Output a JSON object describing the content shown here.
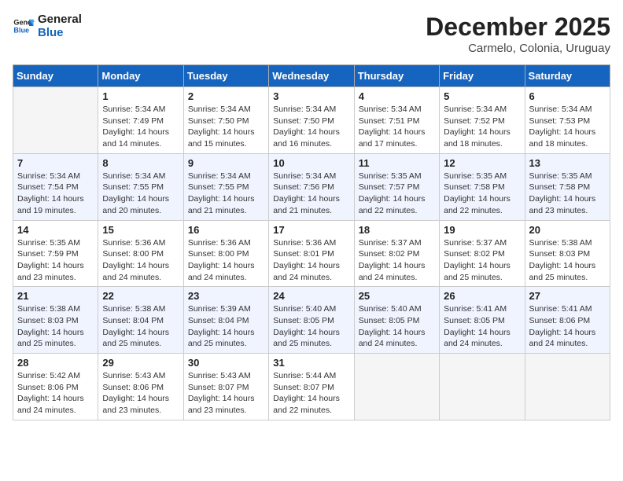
{
  "logo": {
    "line1": "General",
    "line2": "Blue"
  },
  "title": "December 2025",
  "location": "Carmelo, Colonia, Uruguay",
  "days_of_week": [
    "Sunday",
    "Monday",
    "Tuesday",
    "Wednesday",
    "Thursday",
    "Friday",
    "Saturday"
  ],
  "weeks": [
    [
      {
        "num": "",
        "info": ""
      },
      {
        "num": "1",
        "info": "Sunrise: 5:34 AM\nSunset: 7:49 PM\nDaylight: 14 hours\nand 14 minutes."
      },
      {
        "num": "2",
        "info": "Sunrise: 5:34 AM\nSunset: 7:50 PM\nDaylight: 14 hours\nand 15 minutes."
      },
      {
        "num": "3",
        "info": "Sunrise: 5:34 AM\nSunset: 7:50 PM\nDaylight: 14 hours\nand 16 minutes."
      },
      {
        "num": "4",
        "info": "Sunrise: 5:34 AM\nSunset: 7:51 PM\nDaylight: 14 hours\nand 17 minutes."
      },
      {
        "num": "5",
        "info": "Sunrise: 5:34 AM\nSunset: 7:52 PM\nDaylight: 14 hours\nand 18 minutes."
      },
      {
        "num": "6",
        "info": "Sunrise: 5:34 AM\nSunset: 7:53 PM\nDaylight: 14 hours\nand 18 minutes."
      }
    ],
    [
      {
        "num": "7",
        "info": "Sunrise: 5:34 AM\nSunset: 7:54 PM\nDaylight: 14 hours\nand 19 minutes."
      },
      {
        "num": "8",
        "info": "Sunrise: 5:34 AM\nSunset: 7:55 PM\nDaylight: 14 hours\nand 20 minutes."
      },
      {
        "num": "9",
        "info": "Sunrise: 5:34 AM\nSunset: 7:55 PM\nDaylight: 14 hours\nand 21 minutes."
      },
      {
        "num": "10",
        "info": "Sunrise: 5:34 AM\nSunset: 7:56 PM\nDaylight: 14 hours\nand 21 minutes."
      },
      {
        "num": "11",
        "info": "Sunrise: 5:35 AM\nSunset: 7:57 PM\nDaylight: 14 hours\nand 22 minutes."
      },
      {
        "num": "12",
        "info": "Sunrise: 5:35 AM\nSunset: 7:58 PM\nDaylight: 14 hours\nand 22 minutes."
      },
      {
        "num": "13",
        "info": "Sunrise: 5:35 AM\nSunset: 7:58 PM\nDaylight: 14 hours\nand 23 minutes."
      }
    ],
    [
      {
        "num": "14",
        "info": "Sunrise: 5:35 AM\nSunset: 7:59 PM\nDaylight: 14 hours\nand 23 minutes."
      },
      {
        "num": "15",
        "info": "Sunrise: 5:36 AM\nSunset: 8:00 PM\nDaylight: 14 hours\nand 24 minutes."
      },
      {
        "num": "16",
        "info": "Sunrise: 5:36 AM\nSunset: 8:00 PM\nDaylight: 14 hours\nand 24 minutes."
      },
      {
        "num": "17",
        "info": "Sunrise: 5:36 AM\nSunset: 8:01 PM\nDaylight: 14 hours\nand 24 minutes."
      },
      {
        "num": "18",
        "info": "Sunrise: 5:37 AM\nSunset: 8:02 PM\nDaylight: 14 hours\nand 24 minutes."
      },
      {
        "num": "19",
        "info": "Sunrise: 5:37 AM\nSunset: 8:02 PM\nDaylight: 14 hours\nand 25 minutes."
      },
      {
        "num": "20",
        "info": "Sunrise: 5:38 AM\nSunset: 8:03 PM\nDaylight: 14 hours\nand 25 minutes."
      }
    ],
    [
      {
        "num": "21",
        "info": "Sunrise: 5:38 AM\nSunset: 8:03 PM\nDaylight: 14 hours\nand 25 minutes."
      },
      {
        "num": "22",
        "info": "Sunrise: 5:38 AM\nSunset: 8:04 PM\nDaylight: 14 hours\nand 25 minutes."
      },
      {
        "num": "23",
        "info": "Sunrise: 5:39 AM\nSunset: 8:04 PM\nDaylight: 14 hours\nand 25 minutes."
      },
      {
        "num": "24",
        "info": "Sunrise: 5:40 AM\nSunset: 8:05 PM\nDaylight: 14 hours\nand 25 minutes."
      },
      {
        "num": "25",
        "info": "Sunrise: 5:40 AM\nSunset: 8:05 PM\nDaylight: 14 hours\nand 24 minutes."
      },
      {
        "num": "26",
        "info": "Sunrise: 5:41 AM\nSunset: 8:05 PM\nDaylight: 14 hours\nand 24 minutes."
      },
      {
        "num": "27",
        "info": "Sunrise: 5:41 AM\nSunset: 8:06 PM\nDaylight: 14 hours\nand 24 minutes."
      }
    ],
    [
      {
        "num": "28",
        "info": "Sunrise: 5:42 AM\nSunset: 8:06 PM\nDaylight: 14 hours\nand 24 minutes."
      },
      {
        "num": "29",
        "info": "Sunrise: 5:43 AM\nSunset: 8:06 PM\nDaylight: 14 hours\nand 23 minutes."
      },
      {
        "num": "30",
        "info": "Sunrise: 5:43 AM\nSunset: 8:07 PM\nDaylight: 14 hours\nand 23 minutes."
      },
      {
        "num": "31",
        "info": "Sunrise: 5:44 AM\nSunset: 8:07 PM\nDaylight: 14 hours\nand 22 minutes."
      },
      {
        "num": "",
        "info": ""
      },
      {
        "num": "",
        "info": ""
      },
      {
        "num": "",
        "info": ""
      }
    ]
  ]
}
